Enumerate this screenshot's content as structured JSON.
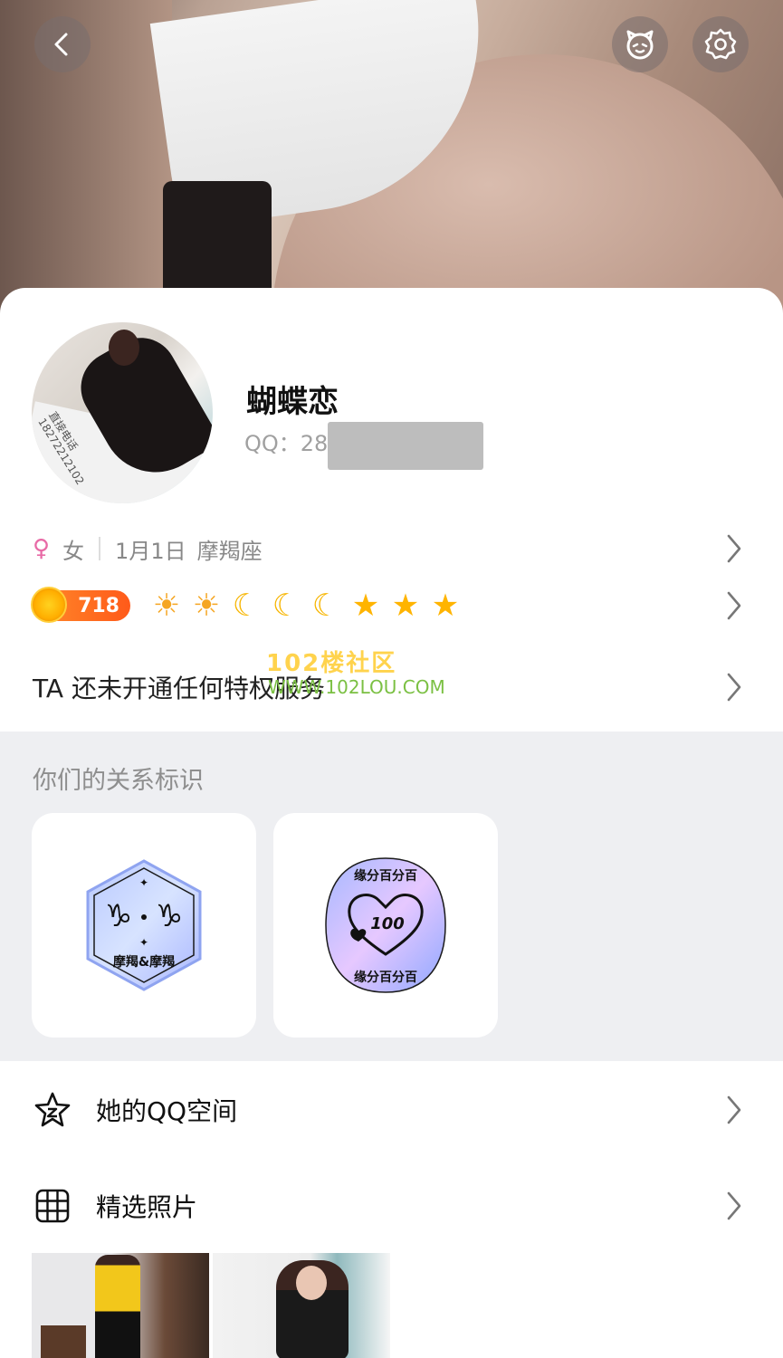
{
  "profile": {
    "nickname": "蝴蝶恋",
    "qq_label": "QQ：28",
    "gender_symbol": "♀",
    "gender": "女",
    "birthday": "1月1日",
    "zodiac": "摩羯座",
    "avatar_watermark_line1": "直接电话",
    "avatar_watermark_line2": "18272212102"
  },
  "level": {
    "value": "718",
    "icons": [
      "sun-icon",
      "sun-icon",
      "moon-icon",
      "moon-icon",
      "moon-icon",
      "star-icon",
      "star-icon",
      "star-icon"
    ]
  },
  "vip": {
    "text": "TA 还未开通任何特权服务"
  },
  "watermark": {
    "line1": "102楼社区",
    "line2": "WWW.102LOU.COM"
  },
  "relation": {
    "title": "你们的关系标识",
    "tags": [
      {
        "label": "摩羯&摩羯",
        "glyph": "♑ ♑"
      },
      {
        "label": "缘分百分百",
        "badge": "100"
      }
    ]
  },
  "menu": {
    "qzone": "她的QQ空间",
    "photos": "精选照片"
  },
  "colors": {
    "level_badge": "#ff6a1f",
    "gender_female": "#e86aa6",
    "section_bg": "#eeeff2"
  }
}
